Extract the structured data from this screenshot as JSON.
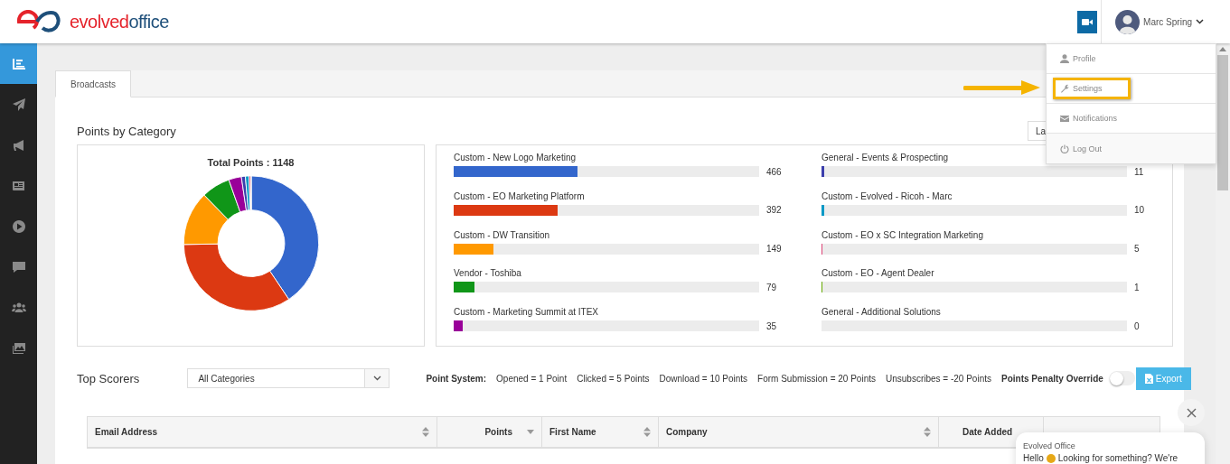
{
  "header": {
    "logo": {
      "part_1": "evolved",
      "part_2": "office"
    },
    "user": {
      "name": "Marc Spring"
    }
  },
  "sidebar": {
    "items": [
      {
        "selected": true
      },
      {
        "selected": false
      },
      {
        "selected": false
      },
      {
        "selected": false
      },
      {
        "selected": false
      },
      {
        "selected": false
      },
      {
        "selected": false
      },
      {
        "selected": false
      }
    ]
  },
  "tabs": [
    {
      "label": "Broadcasts",
      "selected": true
    }
  ],
  "points_by_category": {
    "title": "Points by Category",
    "range_button": "La",
    "donut_title": "Total Points : 1148",
    "bars": [
      {
        "label": "Custom - New Logo Marketing",
        "value": "466",
        "level": 0.406,
        "color": "#3366cc"
      },
      {
        "label": "Custom - EO Marketing Platform",
        "value": "392",
        "level": 0.341,
        "color": "#dc3912"
      },
      {
        "label": "Custom - DW Transition",
        "value": "149",
        "level": 0.13,
        "color": "#ff9900"
      },
      {
        "label": "Vendor - Toshiba",
        "value": "79",
        "level": 0.069,
        "color": "#109618"
      },
      {
        "label": "Custom - Marketing Summit at ITEX",
        "value": "35",
        "level": 0.03,
        "color": "#990099"
      },
      {
        "label": "General - Events & Prospecting",
        "value": "11",
        "level": 0.01,
        "color": "#3b3eac"
      },
      {
        "label": "Custom - Evolved - Ricoh - Marc",
        "value": "10",
        "level": 0.009,
        "color": "#0099c6"
      },
      {
        "label": "Custom - EO x SC Integration Marketing",
        "value": "5",
        "level": 0.004,
        "color": "#dd4477"
      },
      {
        "label": "Custom - EO - Agent Dealer",
        "value": "1",
        "level": 0.001,
        "color": "#66aa00"
      },
      {
        "label": "General - Additional Solutions",
        "value": "0"
      }
    ]
  },
  "top_scorers": {
    "title": "Top Scorers",
    "category_select": "All Categories",
    "point_system": {
      "label": "Point System:",
      "items": [
        "Opened = 1 Point",
        "Clicked = 5 Points",
        "Download = 10 Points",
        "Form Submission = 20 Points",
        "Unsubscribes = -20 Points"
      ]
    },
    "penalty_override": {
      "label": "Points Penalty Override",
      "on": false
    },
    "export_button": "Export",
    "table": {
      "columns": [
        {
          "label": "Email Address",
          "kind": "sortable"
        },
        {
          "label": "Points",
          "kind": "sorted"
        },
        {
          "label": "First Name",
          "kind": "sortable"
        },
        {
          "label": "Company",
          "kind": "sortable"
        },
        {
          "label": "Date Added",
          "kind": "plain"
        },
        {
          "kind": "plain"
        }
      ]
    }
  },
  "user_menu": {
    "items": [
      {
        "label": "Profile",
        "highlighted": false
      },
      {
        "label": "Settings",
        "highlighted": true
      },
      {
        "label": "Notifications",
        "highlighted": false
      },
      {
        "label": "Log Out",
        "highlighted": false
      }
    ]
  },
  "chat": {
    "sender": "Evolved Office",
    "greeting": "Hello",
    "message": "Looking for something? We're"
  }
}
